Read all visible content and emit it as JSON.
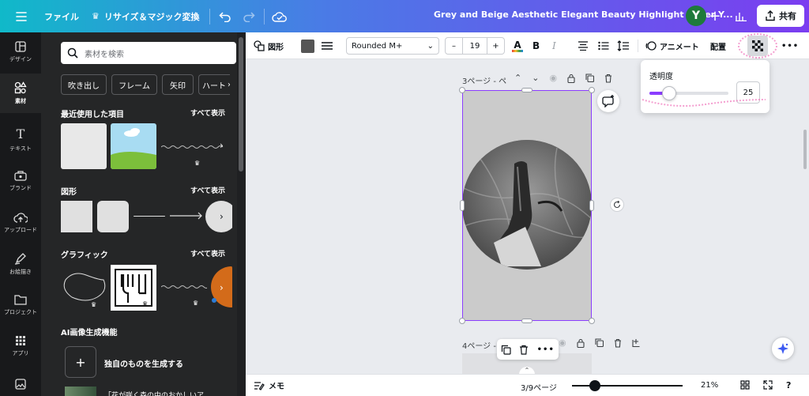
{
  "topbar": {
    "menu_label": "ファイル",
    "resize_label": "リサイズ＆マジック変換",
    "doc_title": "Grey and Beige Aesthetic Elegant Beauty  Highlight Cover Y...",
    "avatar_letter": "Y",
    "share_label": "共有",
    "gradient_colors": [
      "#10b9c9",
      "#4a7be6",
      "#7b3df0"
    ]
  },
  "rail": {
    "items": [
      {
        "label": "デザイン",
        "icon": "layout-icon"
      },
      {
        "label": "素材",
        "icon": "elements-icon"
      },
      {
        "label": "テキスト",
        "icon": "text-icon"
      },
      {
        "label": "ブランド",
        "icon": "brand-icon"
      },
      {
        "label": "アップロード",
        "icon": "upload-icon"
      },
      {
        "label": "お絵描き",
        "icon": "draw-icon"
      },
      {
        "label": "プロジェクト",
        "icon": "folder-icon"
      },
      {
        "label": "アプリ",
        "icon": "apps-icon"
      }
    ]
  },
  "panel": {
    "search_placeholder": "素材を検索",
    "chips": [
      "吹き出し",
      "フレーム",
      "矢印",
      "ハート"
    ],
    "sections": {
      "recent": {
        "title": "最近使用した項目",
        "see_all": "すべて表示"
      },
      "shapes": {
        "title": "図形",
        "see_all": "すべて表示"
      },
      "graphics": {
        "title": "グラフィック",
        "see_all": "すべて表示"
      },
      "ai": {
        "title": "AI画像生成機能",
        "create_label": "独自のものを生成する",
        "preview_text": "「花が咲く森の中のおかしいア"
      }
    }
  },
  "toolbar": {
    "shape_label": "図形",
    "font_name": "Rounded M+",
    "font_size": "19",
    "minus": "–",
    "plus": "+",
    "bold": "B",
    "italic": "I",
    "animate_label": "アニメート",
    "arrange_label": "配置",
    "more": "•••",
    "fill_color": "#555555"
  },
  "canvas": {
    "page3_label": "3ページ - ペ",
    "page4_label": "4ページ - ",
    "page_bg": "#cbcbcb"
  },
  "transparency": {
    "label": "透明度",
    "value": "25",
    "level": 0.25
  },
  "bottombar": {
    "notes_label": "メモ",
    "page_indicator": "3/9ページ",
    "zoom": "21%",
    "zoom_level": 0.21
  }
}
